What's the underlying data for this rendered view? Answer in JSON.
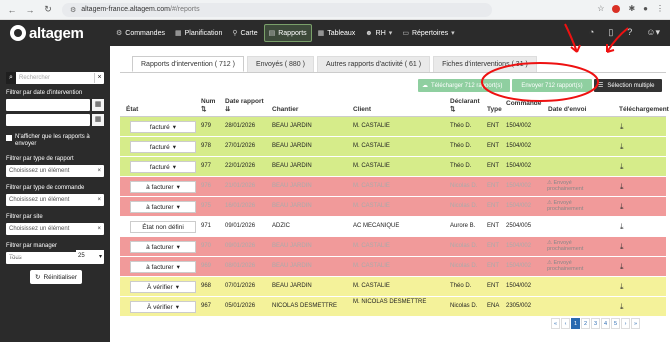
{
  "browser": {
    "url_host": "altagem-france.altagem.com",
    "url_path": "/#/reports"
  },
  "app": {
    "logo_text": "altagem",
    "menu": [
      {
        "label": "Commandes",
        "icon": "gears-icon"
      },
      {
        "label": "Planification",
        "icon": "calendar-icon"
      },
      {
        "label": "Carte",
        "icon": "map-pin-icon"
      },
      {
        "label": "Rapports",
        "icon": "clipboard-icon"
      },
      {
        "label": "Tableaux",
        "icon": "table-icon"
      },
      {
        "label": "RH",
        "icon": "users-icon"
      },
      {
        "label": "Répertoires",
        "icon": "folder-icon"
      }
    ]
  },
  "sidebar": {
    "search_placeholder": "Rechercher",
    "filter_date_label": "Filtrer par date d'intervention",
    "checkbox_label": "N'afficher que les rapports à envoyer",
    "type_rapport_label": "Filtrer par type de rapport",
    "type_rapport_placeholder": "Choisissez un élément",
    "type_commande_label": "Filtrer par type de commande",
    "type_commande_placeholder": "Choisissez un élément",
    "site_label": "Filtrer par site",
    "site_placeholder": "Choisissez un élément",
    "manager_label": "Filtrer par manager",
    "manager_value": "Tous",
    "per_page_label": "Résultats par page",
    "per_page_value": "25",
    "reset_label": "Réinitialiser"
  },
  "tabs": [
    "Rapports d'intervention ( 712 )",
    "Envoyés ( 880 )",
    "Autres rapports d'activité ( 61 )",
    "Fiches d'interventions ( 31 )"
  ],
  "actions": {
    "download": "Télécharger 712 rapport(s)",
    "send": "Envoyer 712 rapport(s)",
    "multi": "Sélection multiple"
  },
  "columns": {
    "etat": "État",
    "num": "Num",
    "date": "Date rapport",
    "chantier": "Chantier",
    "client": "Client",
    "declarant": "Déclarant",
    "type": "Type",
    "commande": "Commande",
    "envoi": "Date d'envoi",
    "dl": "Téléchargement"
  },
  "colors": {
    "green_row": "#d6ec8a",
    "red_row": "#f19a9a",
    "yellow_row": "#f4f29a",
    "accent": "#8fcfa0"
  },
  "rows": [
    {
      "etat": "facturé",
      "num": "979",
      "date": "28/01/2026",
      "chantier": "BEAU JARDIN",
      "client": "M. CASTALIE",
      "declarant": "Théo D.",
      "type": "ENT",
      "commande": "1504/002",
      "envoi": "",
      "color": "#d6ec8a",
      "muted": false
    },
    {
      "etat": "facturé",
      "num": "978",
      "date": "27/01/2026",
      "chantier": "BEAU JARDIN",
      "client": "M. CASTALIE",
      "declarant": "Théo D.",
      "type": "ENT",
      "commande": "1504/002",
      "envoi": "",
      "color": "#d6ec8a",
      "muted": false
    },
    {
      "etat": "facturé",
      "num": "977",
      "date": "22/01/2026",
      "chantier": "BEAU JARDIN",
      "client": "M. CASTALIE",
      "declarant": "Théo D.",
      "type": "ENT",
      "commande": "1504/002",
      "envoi": "",
      "color": "#d6ec8a",
      "muted": false
    },
    {
      "etat": "à facturer",
      "num": "976",
      "date": "21/01/2026",
      "chantier": "BEAU JARDIN",
      "client": "M. CASTALIE",
      "declarant": "Nicolas D.",
      "type": "ENT",
      "commande": "1504/002",
      "envoi": "Envoyé prochainement",
      "color": "#f19a9a",
      "muted": true
    },
    {
      "etat": "à facturer",
      "num": "975",
      "date": "16/01/2026",
      "chantier": "BEAU JARDIN",
      "client": "M. CASTALIE",
      "declarant": "Nicolas D.",
      "type": "ENT",
      "commande": "1504/002",
      "envoi": "Envoyé prochainement",
      "color": "#f19a9a",
      "muted": true
    },
    {
      "etat": "État non défini",
      "num": "971",
      "date": "09/01/2026",
      "chantier": "ADZIC",
      "client": "AC MECANIQUE",
      "declarant": "Aurore B.",
      "type": "ENT",
      "commande": "2504/005",
      "envoi": "",
      "color": "#ffffff",
      "muted": false
    },
    {
      "etat": "à facturer",
      "num": "970",
      "date": "09/01/2026",
      "chantier": "BEAU JARDIN",
      "client": "M. CASTALIE",
      "declarant": "Nicolas D.",
      "type": "ENT",
      "commande": "1504/002",
      "envoi": "Envoyé prochainement",
      "color": "#f19a9a",
      "muted": true
    },
    {
      "etat": "à facturer",
      "num": "969",
      "date": "08/01/2026",
      "chantier": "BEAU JARDIN",
      "client": "M. CASTALIE",
      "declarant": "Nicolas D.",
      "type": "ENT",
      "commande": "1504/002",
      "envoi": "Envoyé prochainement",
      "color": "#f19a9a",
      "muted": true
    },
    {
      "etat": "À vérifier",
      "num": "968",
      "date": "07/01/2026",
      "chantier": "BEAU JARDIN",
      "client": "M. CASTALIE",
      "declarant": "Théo D.",
      "type": "ENT",
      "commande": "1504/002",
      "envoi": "",
      "color": "#f4f29a",
      "muted": false
    },
    {
      "etat": "À vérifier",
      "num": "967",
      "date": "05/01/2026",
      "chantier": "NICOLAS DESMETTRE",
      "client": "M. NICOLAS DESMETTRE",
      "declarant": "Nicolas D.",
      "type": "ENA",
      "commande": "2305/002",
      "envoi": "",
      "color": "#f4f29a",
      "muted": false
    }
  ],
  "pager": [
    "«",
    "‹",
    "1",
    "2",
    "3",
    "4",
    "5",
    "›",
    "»"
  ]
}
